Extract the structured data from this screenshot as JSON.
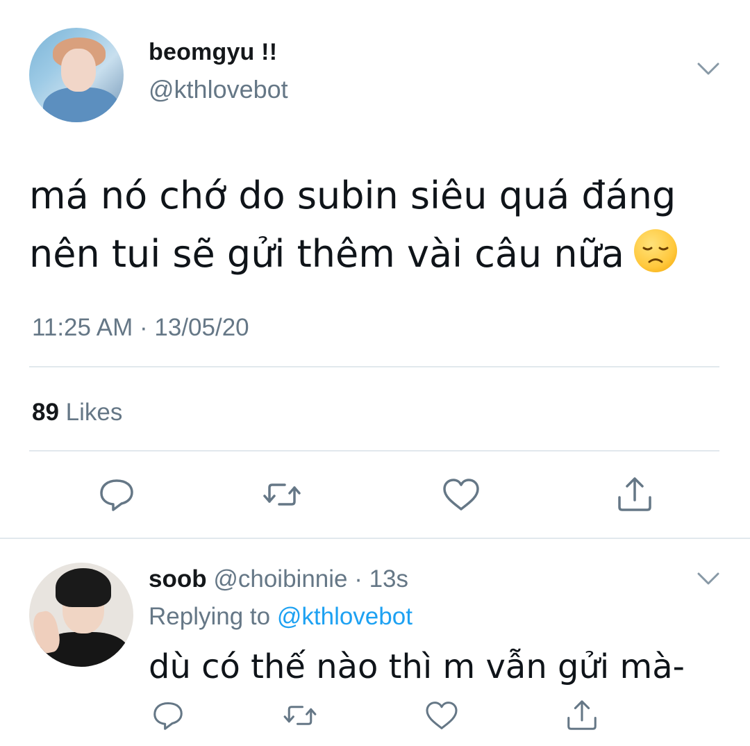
{
  "tweet": {
    "display_name": "beomgyu !!",
    "handle": "@kthlovebot",
    "text_line1": "má nó chớ do subin siêu quá đáng",
    "text_line2": "nên tui sẽ gửi thêm vài câu nữa",
    "emoji": "disappointed-face-emoji",
    "timestamp": "11:25 AM · 13/05/20",
    "likes_count": "89",
    "likes_label": "Likes",
    "actions": [
      "reply-icon",
      "retweet-icon",
      "like-icon",
      "share-icon"
    ]
  },
  "reply": {
    "display_name": "soob",
    "handle_time": "@choibinnie · 13s",
    "replying_prefix": "Replying to",
    "replying_mention": "@kthlovebot",
    "text": "dù có thế nào thì m vẫn gửi mà-",
    "actions": [
      "reply-icon",
      "retweet-icon",
      "like-icon",
      "share-icon"
    ]
  },
  "colors": {
    "secondary_text": "#657786",
    "link": "#1da1f2",
    "divider": "#e1e8ed",
    "primary_text": "#14171a"
  }
}
